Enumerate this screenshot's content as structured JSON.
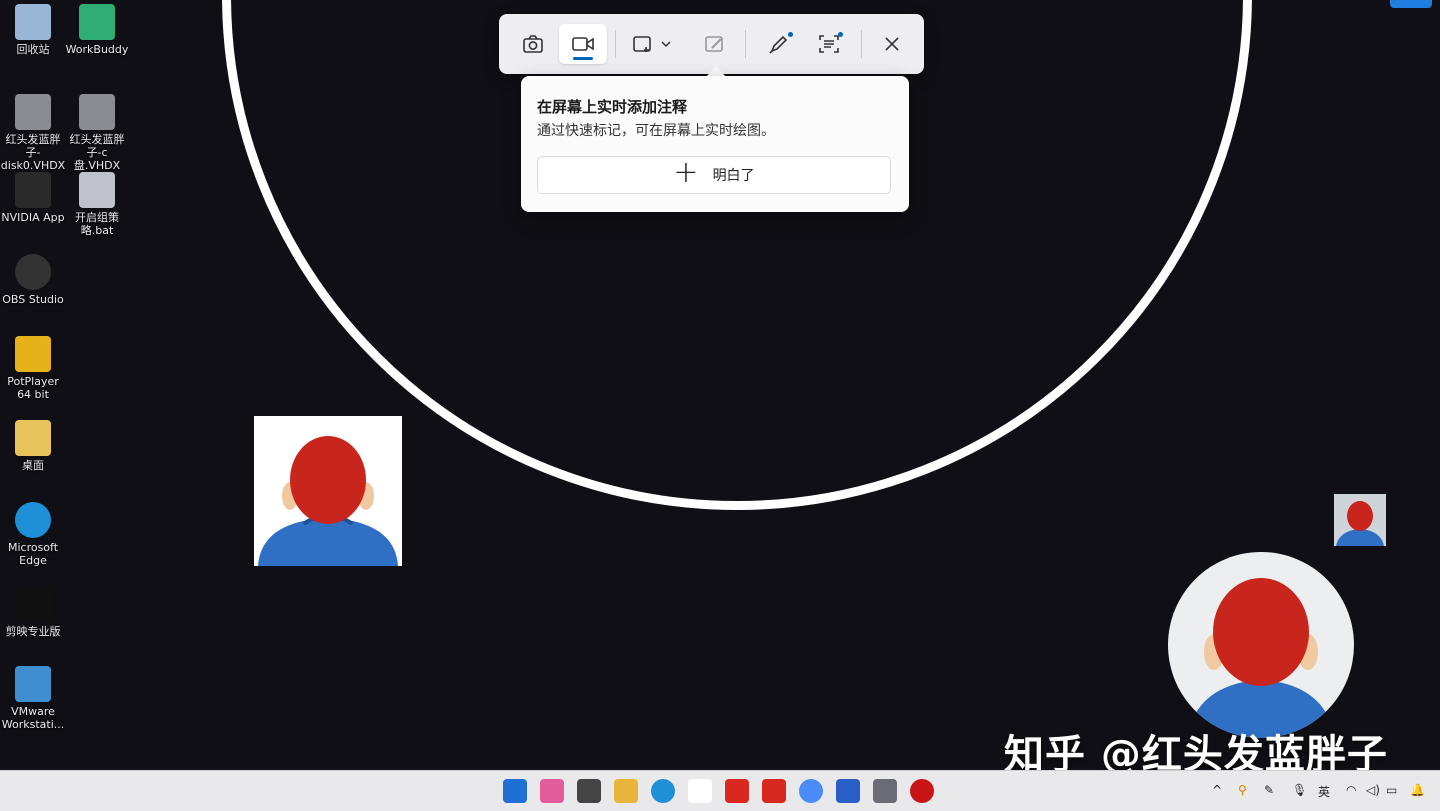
{
  "desktop": {
    "icons": [
      {
        "label": "回收站",
        "icon": "recycle-bin-icon"
      },
      {
        "label": "WorkBuddy",
        "icon": "workbuddy-icon"
      },
      {
        "label": "红头发蓝胖子-disk0.VHDX",
        "icon": "vhdx-drive-icon"
      },
      {
        "label": "红头发蓝胖子-c盘.VHDX",
        "icon": "vhdx-drive-icon"
      },
      {
        "label": "NVIDIA App",
        "icon": "nvidia-icon"
      },
      {
        "label": "开启组策略.bat",
        "icon": "bat-file-icon"
      },
      {
        "label": "OBS Studio",
        "icon": "obs-icon"
      },
      {
        "label": "PotPlayer 64 bit",
        "icon": "potplayer-icon"
      },
      {
        "label": "桌面",
        "icon": "folder-icon"
      },
      {
        "label": "Microsoft Edge",
        "icon": "edge-icon"
      },
      {
        "label": "剪映专业版",
        "icon": "capcut-icon"
      },
      {
        "label": "VMware Workstati...",
        "icon": "vmware-icon"
      }
    ]
  },
  "snipping_toolbar": {
    "buttons": [
      "camera-icon",
      "video-icon",
      "snip-mode-icon",
      "edit-image-icon",
      "pen-icon",
      "text-actions-icon",
      "close-icon"
    ]
  },
  "tip": {
    "title": "在屏幕上实时添加注释",
    "body": "通过快速标记，可在屏幕上实时绘图。",
    "button_label": "明白了",
    "button_icon": "+"
  },
  "watermark": "知乎 @红头发蓝胖子",
  "taskbar": {
    "apps": [
      "windows-start-icon",
      "ai-app-icon",
      "task-view-icon",
      "file-explorer-icon",
      "edge-icon",
      "panda-app-icon",
      "wps-icon",
      "pdf-icon",
      "chrome-icon",
      "shield-app-icon",
      "settings-icon",
      "record-icon"
    ],
    "tray": {
      "chevron": "^",
      "ime": "英"
    }
  },
  "colors": {
    "desktop_bg": "#0f0f15",
    "accent": "#0067c0",
    "ring": "#ffffff"
  }
}
